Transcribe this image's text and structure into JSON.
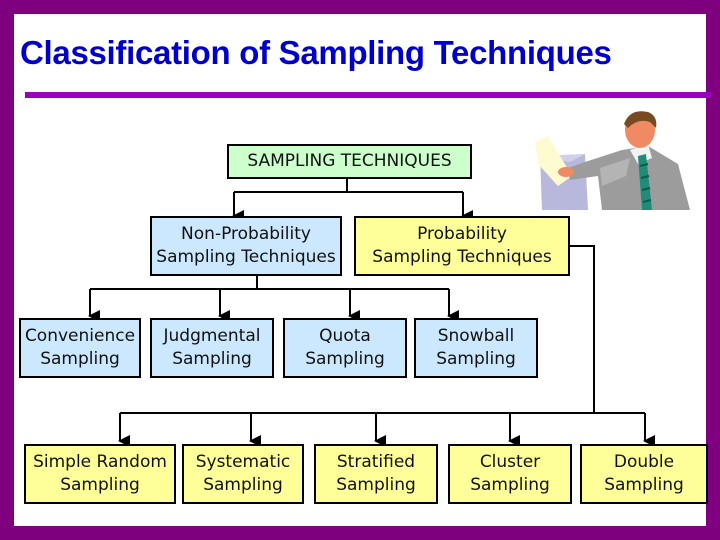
{
  "slide": {
    "title": "Classification of Sampling Techniques"
  },
  "diagram": {
    "root": "SAMPLING TECHNIQUES",
    "non_probability": {
      "label": "Non-Probability\nSampling Techniques",
      "children": [
        "Convenience\nSampling",
        "Judgmental\nSampling",
        "Quota\nSampling",
        "Snowball\nSampling"
      ]
    },
    "probability": {
      "label": "Probability\nSampling Techniques",
      "children": [
        "Simple Random\nSampling",
        "Systematic\nSampling",
        "Stratified\nSampling",
        "Cluster\nSampling",
        "Double\nSampling"
      ]
    }
  },
  "illustration": {
    "icon": "businessman-voting-icon"
  }
}
